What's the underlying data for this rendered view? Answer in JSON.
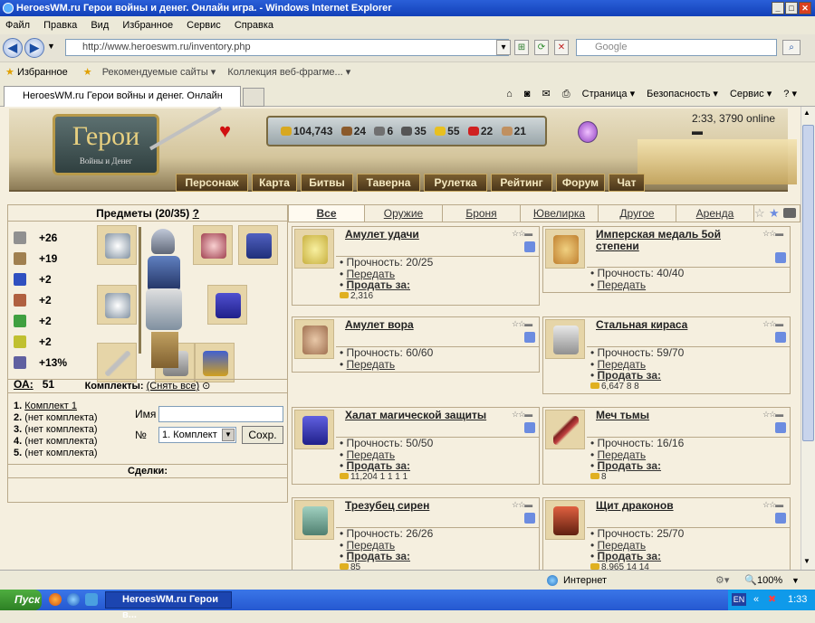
{
  "window": {
    "title": "HeroesWM.ru Герои войны и денег. Онлайн игра. - Windows Internet Explorer"
  },
  "menu": [
    "Файл",
    "Правка",
    "Вид",
    "Избранное",
    "Сервис",
    "Справка"
  ],
  "address": {
    "url": "http://www.heroeswm.ru/inventory.php"
  },
  "search": {
    "placeholder": "Google"
  },
  "favorites": {
    "label": "Избранное",
    "items": [
      "Рекомендуемые сайты ▾",
      "Коллекция веб-фрагме... ▾"
    ]
  },
  "tab": {
    "title": "HeroesWM.ru Герои войны и денег. Онлайн игра."
  },
  "toolbar_right": {
    "page": "Страница ▾",
    "security": "Безопасность ▾",
    "service": "Сервис ▾",
    "help": "? ▾"
  },
  "banner": {
    "logo_title": "Герои",
    "logo_sub": "Войны и Денег",
    "resources": [
      {
        "value": "104,743",
        "color": "#d8a820"
      },
      {
        "value": "24",
        "color": "#8b5a2b"
      },
      {
        "value": "6",
        "color": "#707070"
      },
      {
        "value": "35",
        "color": "#555555"
      },
      {
        "value": "55",
        "color": "#e8c020"
      },
      {
        "value": "22",
        "color": "#d02020"
      },
      {
        "value": "21",
        "color": "#c09060"
      }
    ],
    "online": "2:33, 3790 online",
    "nav": [
      "Персонаж",
      "Карта",
      "Битвы",
      "Таверна",
      "Рулетка",
      "Рейтинг",
      "Форум",
      "Чат"
    ]
  },
  "items_panel": {
    "title": "Предметы (20/35)",
    "help": "?",
    "stats": [
      {
        "value": "+26",
        "color": "#909090"
      },
      {
        "value": "+19",
        "color": "#a08050"
      },
      {
        "value": "+2",
        "color": "#3050c0"
      },
      {
        "value": "+2",
        "color": "#b06040"
      },
      {
        "value": "+2",
        "color": "#40a040"
      },
      {
        "value": "+2",
        "color": "#c0c030"
      },
      {
        "value": "+13%",
        "color": "#6060a0"
      }
    ],
    "oa_label": "ОА:",
    "oa_value": "51",
    "sets_label": "Комплекты:",
    "sets_remove": "(Снять все)",
    "sets": [
      {
        "num": "1.",
        "name": "Комплект 1"
      },
      {
        "num": "2.",
        "name": "(нет комплекта)"
      },
      {
        "num": "3.",
        "name": "(нет комплекта)"
      },
      {
        "num": "4.",
        "name": "(нет комплекта)"
      },
      {
        "num": "5.",
        "name": "(нет комплекта)"
      }
    ],
    "name_label": "Имя",
    "num_label": "№",
    "select_value": "1. Комплект",
    "save_label": "Сохр.",
    "deals_label": "Сделки:"
  },
  "categories": [
    "Все",
    "Оружие",
    "Броня",
    "Ювелирка",
    "Другое",
    "Аренда"
  ],
  "cards": [
    {
      "name": "Амулет удачи",
      "durability": "Прочность: 20/25",
      "transfer": "Передать",
      "sell": "Продать за:",
      "price": "2,316",
      "color": "#c8b040"
    },
    {
      "name": "Имперская медаль 5ой степени",
      "durability": "Прочность: 40/40",
      "transfer": "Передать",
      "color": "#c08030"
    },
    {
      "name": "Амулет вора",
      "durability": "Прочность: 60/60",
      "transfer": "Передать",
      "color": "#a07050"
    },
    {
      "name": "Стальная кираса",
      "durability": "Прочность: 59/70",
      "transfer": "Передать",
      "sell": "Продать за:",
      "price": "6,647",
      "extra": "8 8",
      "color": "#b0b0b0"
    },
    {
      "name": "Халат магической защиты",
      "durability": "Прочность: 50/50",
      "transfer": "Передать",
      "sell": "Продать за:",
      "price": "11,204",
      "extra": "1 1 1 1",
      "color": "#4040c0"
    },
    {
      "name": "Меч тьмы",
      "durability": "Прочность: 16/16",
      "transfer": "Передать",
      "sell": "Продать за:",
      "price": "8",
      "color": "#802020"
    },
    {
      "name": "Трезубец сирен",
      "durability": "Прочность: 26/26",
      "transfer": "Передать",
      "sell": "Продать за:",
      "price": "85",
      "color": "#70a090"
    },
    {
      "name": "Щит драконов",
      "durability": "Прочность: 25/70",
      "transfer": "Передать",
      "sell": "Продать за:",
      "price": "8,965",
      "extra": "14 14",
      "color": "#a03020"
    }
  ],
  "status": {
    "zone": "Интернет",
    "zoom": "100%"
  },
  "taskbar": {
    "start": "Пуск",
    "item": "HeroesWM.ru Герои в...",
    "lang": "EN",
    "clock": "1:33"
  }
}
